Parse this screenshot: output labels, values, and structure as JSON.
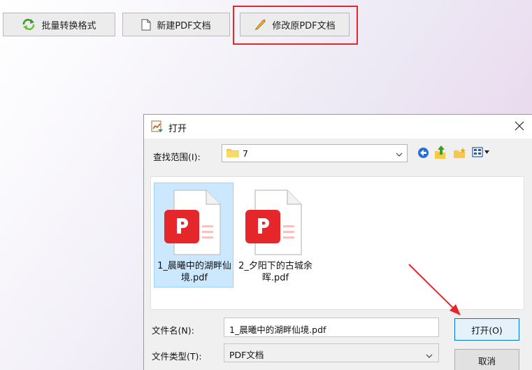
{
  "toolbar": {
    "batch_convert": "批量转换格式",
    "new_pdf": "新建PDF文档",
    "modify_pdf": "修改原PDF文档"
  },
  "dialog": {
    "title": "打开",
    "look_in_label": "查找范围(I):",
    "look_in_value": "7",
    "files": [
      {
        "name": "1_晨曦中的湖畔仙境.pdf",
        "line1": "1_晨曦中的湖畔仙",
        "line2": "境.pdf",
        "selected": true
      },
      {
        "name": "2_夕阳下的古城余晖.pdf",
        "line1": "2_夕阳下的古城余",
        "line2": "晖.pdf",
        "selected": false
      }
    ],
    "filename_label": "文件名(N):",
    "filename_value": "1_晨曦中的湖畔仙境.pdf",
    "filetype_label": "文件类型(T):",
    "filetype_value": "PDF文档",
    "open_button": "打开(O)",
    "cancel_button": "取消"
  },
  "colors": {
    "highlight_box": "#e5262a",
    "annotation_arrow": "#e5262a",
    "pdf_icon": "#e5262a",
    "selection": "#cce8ff"
  },
  "icons": {
    "batch_convert": "refresh-arrows-icon",
    "new_pdf": "blank-document-icon",
    "modify_pdf": "pencil-icon"
  }
}
